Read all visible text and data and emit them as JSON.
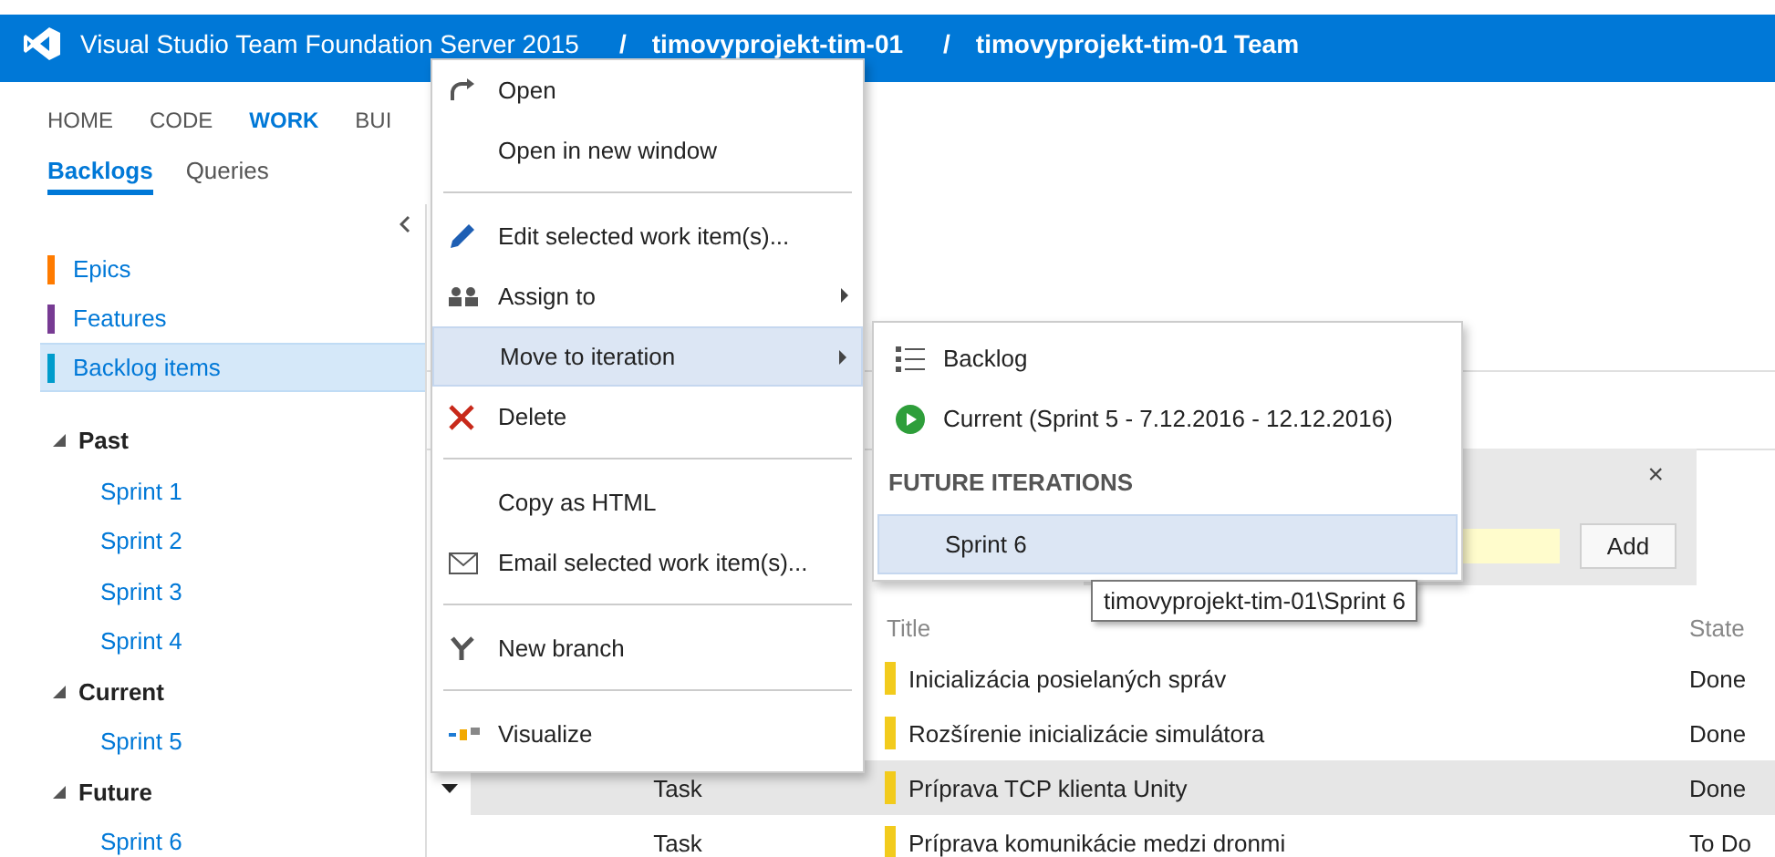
{
  "header": {
    "product": "Visual Studio Team Foundation Server 2015",
    "breadcrumbs": [
      {
        "separator": "/",
        "label": "timovyprojekt-tim-01"
      },
      {
        "separator": "/",
        "label": "timovyprojekt-tim-01 Team"
      }
    ]
  },
  "nav": [
    {
      "label": "HOME",
      "selected": false
    },
    {
      "label": "CODE",
      "selected": false
    },
    {
      "label": "WORK",
      "selected": true
    },
    {
      "label": "BUI",
      "selected": false
    }
  ],
  "subtabs": [
    {
      "label": "Backlogs",
      "selected": true
    },
    {
      "label": "Queries",
      "selected": false
    }
  ],
  "sidebar": {
    "backlogs": [
      {
        "label": "Epics",
        "color": "#ff7b00",
        "selected": false
      },
      {
        "label": "Features",
        "color": "#773b93",
        "selected": false
      },
      {
        "label": "Backlog items",
        "color": "#009ccc",
        "selected": true
      }
    ],
    "iterations": [
      {
        "label": "Past",
        "expanded": true,
        "children": [
          {
            "label": "Sprint 1"
          },
          {
            "label": "Sprint 2"
          },
          {
            "label": "Sprint 3"
          },
          {
            "label": "Sprint 4"
          }
        ]
      },
      {
        "label": "Current",
        "expanded": true,
        "children": [
          {
            "label": "Sprint 5"
          }
        ]
      },
      {
        "label": "Future",
        "expanded": true,
        "children": [
          {
            "label": "Sprint 6"
          }
        ]
      }
    ]
  },
  "panel": {
    "close": "×",
    "button": "Add"
  },
  "table": {
    "columns": [
      "Title",
      "State"
    ],
    "rows": [
      {
        "title": "Inicializácia posielaných správ",
        "state": "Done",
        "selected": false
      },
      {
        "title": "Rozšírenie inicializácie simulátora",
        "state": "Done",
        "selected": false
      },
      {
        "type": "Task",
        "title": "Príprava TCP klienta Unity",
        "state": "Done",
        "selected": true,
        "expanded": true
      },
      {
        "type": "Task",
        "title": "Príprava komunikácie medzi dronmi",
        "state": "To Do",
        "selected": false
      }
    ]
  },
  "context_menu": [
    {
      "kind": "item",
      "label": "Open",
      "submenu": false,
      "selected": false
    },
    {
      "kind": "item",
      "label": "Open in new window",
      "submenu": false,
      "selected": false
    },
    {
      "kind": "separator"
    },
    {
      "kind": "item",
      "label": "Edit selected work item(s)...",
      "submenu": false,
      "selected": false
    },
    {
      "kind": "item",
      "label": "Assign to",
      "submenu": true,
      "selected": false
    },
    {
      "kind": "item",
      "label": "Move to iteration",
      "submenu": true,
      "selected": true
    },
    {
      "kind": "item",
      "label": "Delete",
      "submenu": false,
      "selected": false
    },
    {
      "kind": "separator"
    },
    {
      "kind": "item",
      "label": "Copy as HTML",
      "submenu": false,
      "selected": false
    },
    {
      "kind": "item",
      "label": "Email selected work item(s)...",
      "submenu": false,
      "selected": false
    },
    {
      "kind": "separator"
    },
    {
      "kind": "item",
      "label": "New branch",
      "submenu": false,
      "selected": false
    },
    {
      "kind": "separator"
    },
    {
      "kind": "item",
      "label": "Visualize",
      "submenu": false,
      "selected": false
    }
  ],
  "submenu": [
    {
      "kind": "item",
      "label": "Backlog",
      "selected": false
    },
    {
      "kind": "item",
      "label": "Current (Sprint 5 - 7.12.2016 - 12.12.2016)",
      "selected": false
    },
    {
      "kind": "heading",
      "label": "FUTURE ITERATIONS"
    },
    {
      "kind": "item",
      "label": "Sprint 6",
      "selected": true
    }
  ],
  "tooltip": "timovyprojekt-tim-01\\Sprint 6"
}
